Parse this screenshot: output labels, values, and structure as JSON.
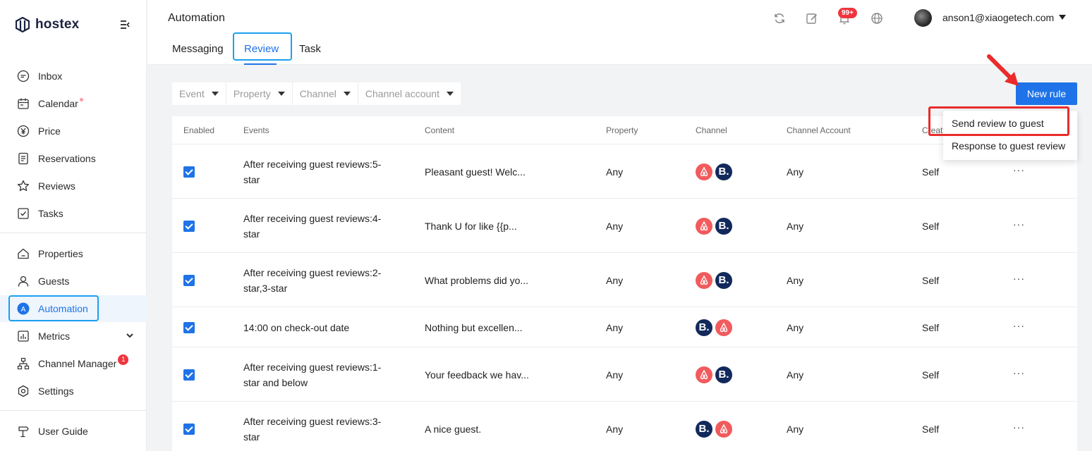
{
  "app": {
    "brand": "hostex"
  },
  "sidebar": {
    "items": [
      {
        "label": "Inbox",
        "icon": "inbox-icon"
      },
      {
        "label": "Calendar",
        "icon": "calendar-icon"
      },
      {
        "label": "Price",
        "icon": "yen-icon"
      },
      {
        "label": "Reservations",
        "icon": "document-icon"
      },
      {
        "label": "Reviews",
        "icon": "star-icon"
      },
      {
        "label": "Tasks",
        "icon": "checklist-icon"
      },
      {
        "label": "Properties",
        "icon": "home-icon"
      },
      {
        "label": "Guests",
        "icon": "user-icon"
      },
      {
        "label": "Automation",
        "icon": "automation-icon",
        "active": true
      },
      {
        "label": "Metrics",
        "icon": "chart-icon"
      },
      {
        "label": "Channel Manager",
        "icon": "network-icon",
        "badge": "1"
      },
      {
        "label": "Settings",
        "icon": "gear-icon"
      },
      {
        "label": "User Guide",
        "icon": "signpost-icon"
      }
    ]
  },
  "header": {
    "title": "Automation",
    "tabs": [
      "Messaging",
      "Review",
      "Task"
    ],
    "active_tab": "Review",
    "notification_badge": "99+",
    "user_email": "anson1@xiaogetech.com"
  },
  "filters": {
    "event": "Event",
    "property": "Property",
    "channel": "Channel",
    "channel_account": "Channel account"
  },
  "new_rule_button": "New rule",
  "dropdown": {
    "items": [
      "Send review to guest",
      "Response to guest review"
    ]
  },
  "table": {
    "headers": [
      "Enabled",
      "Events",
      "Content",
      "Property",
      "Channel",
      "Channel Account",
      "Creat"
    ],
    "rows": [
      {
        "events_line1": "After receiving guest reviews:5-",
        "events_line2": "star",
        "content": "Pleasant guest! Welc...",
        "property": "Any",
        "channels": [
          "airbnb",
          "booking"
        ],
        "account": "Any",
        "creator": "Self"
      },
      {
        "events_line1": "After receiving guest reviews:4-",
        "events_line2": "star",
        "content": "Thank U for like {{p...",
        "property": "Any",
        "channels": [
          "airbnb",
          "booking"
        ],
        "account": "Any",
        "creator": "Self"
      },
      {
        "events_line1": "After receiving guest reviews:2-",
        "events_line2": "star,3-star",
        "content": "What problems did yo...",
        "property": "Any",
        "channels": [
          "airbnb",
          "booking"
        ],
        "account": "Any",
        "creator": "Self"
      },
      {
        "events_line1": "14:00 on check-out date",
        "events_line2": "",
        "content": "Nothing but excellen...",
        "property": "Any",
        "channels": [
          "booking",
          "airbnb"
        ],
        "account": "Any",
        "creator": "Self"
      },
      {
        "events_line1": "After receiving guest reviews:1-",
        "events_line2": "star and below",
        "content": "Your feedback we hav...",
        "property": "Any",
        "channels": [
          "airbnb",
          "booking"
        ],
        "account": "Any",
        "creator": "Self"
      },
      {
        "events_line1": "After receiving guest reviews:3-",
        "events_line2": "star",
        "content": "A nice guest.",
        "property": "Any",
        "channels": [
          "booking",
          "airbnb"
        ],
        "account": "Any",
        "creator": "Self"
      }
    ],
    "more_label": "···",
    "booking_letter": "B."
  },
  "colors": {
    "accent": "#1f73e8",
    "airbnb": "#f15b5d",
    "booking": "#12295b",
    "highlight": "#1aa0f0",
    "annotation": "#ea2b2b"
  }
}
